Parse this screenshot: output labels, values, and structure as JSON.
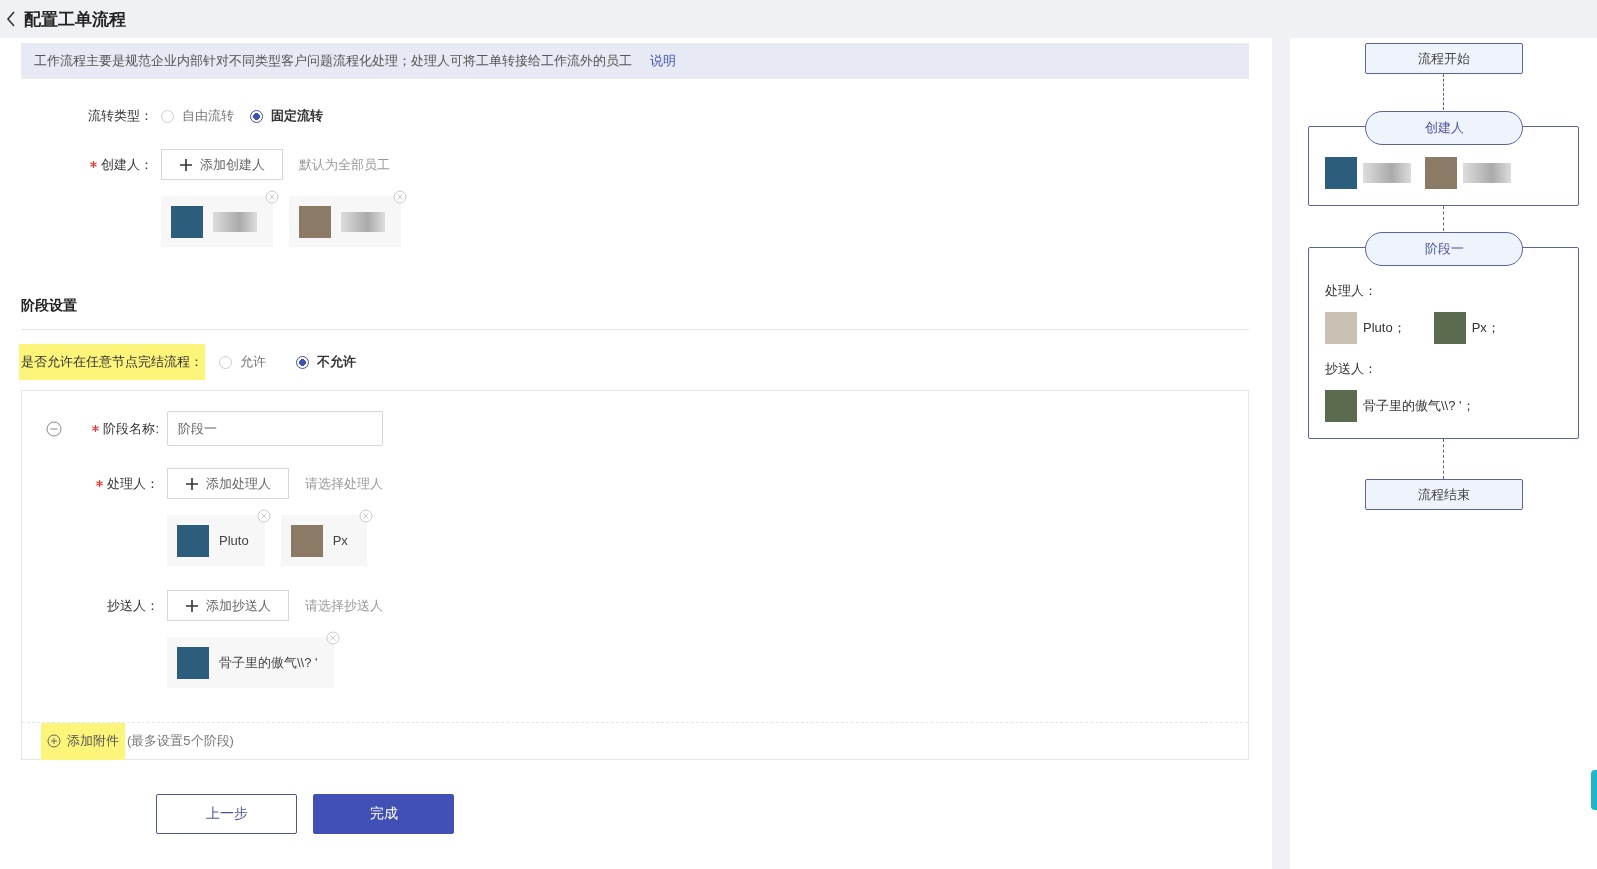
{
  "header": {
    "title": "配置工单流程"
  },
  "notice": {
    "text": "工作流程主要是规范企业内部针对不同类型客户问题流程化处理；处理人可将工单转接给工作流外的员工",
    "link": "说明"
  },
  "flow_type": {
    "label": "流转类型：",
    "options": [
      {
        "label": "自由流转",
        "selected": false
      },
      {
        "label": "固定流转",
        "selected": true
      }
    ]
  },
  "creator": {
    "label": "创建人：",
    "required": true,
    "button": "添加创建人",
    "hint": "默认为全部员工",
    "people": [
      {
        "blurred": true
      },
      {
        "blurred": true
      }
    ]
  },
  "stage_settings": {
    "title": "阶段设置",
    "allow_finish": {
      "label": "是否允许在任意节点完结流程：",
      "highlighted": true,
      "options": [
        {
          "label": "允许",
          "selected": false
        },
        {
          "label": "不允许",
          "selected": true
        }
      ]
    },
    "stages": [
      {
        "name_required": true,
        "name_label": "阶段名称:",
        "name_value": "阶段一",
        "handler": {
          "label": "处理人：",
          "required": true,
          "button": "添加处理人",
          "hint": "请选择处理人",
          "people": [
            {
              "name": "Pluto"
            },
            {
              "name": "Px"
            }
          ]
        },
        "cc": {
          "label": "抄送人：",
          "required": false,
          "button": "添加抄送人",
          "hint": "请选择抄送人",
          "people": [
            {
              "name": "骨子里的傲气\\\\? '"
            }
          ]
        }
      }
    ],
    "add": {
      "label": "添加附件",
      "highlighted": true,
      "note": "(最多设置5个阶段)"
    }
  },
  "buttons": [
    {
      "label": "上一步",
      "kind": "secondary"
    },
    {
      "label": "完成",
      "kind": "primary"
    }
  ],
  "flow_preview": {
    "start": "流程开始",
    "creator_group": {
      "title": "创建人",
      "people": [
        {
          "blurred": true
        },
        {
          "blurred": true
        }
      ]
    },
    "stage": {
      "title": "阶段一",
      "handler_label": "处理人：",
      "handlers": [
        "Pluto；",
        "Px；"
      ],
      "cc_label": "抄送人：",
      "cc": [
        "骨子里的傲气\\\\? '；"
      ]
    },
    "end": "流程结束"
  }
}
